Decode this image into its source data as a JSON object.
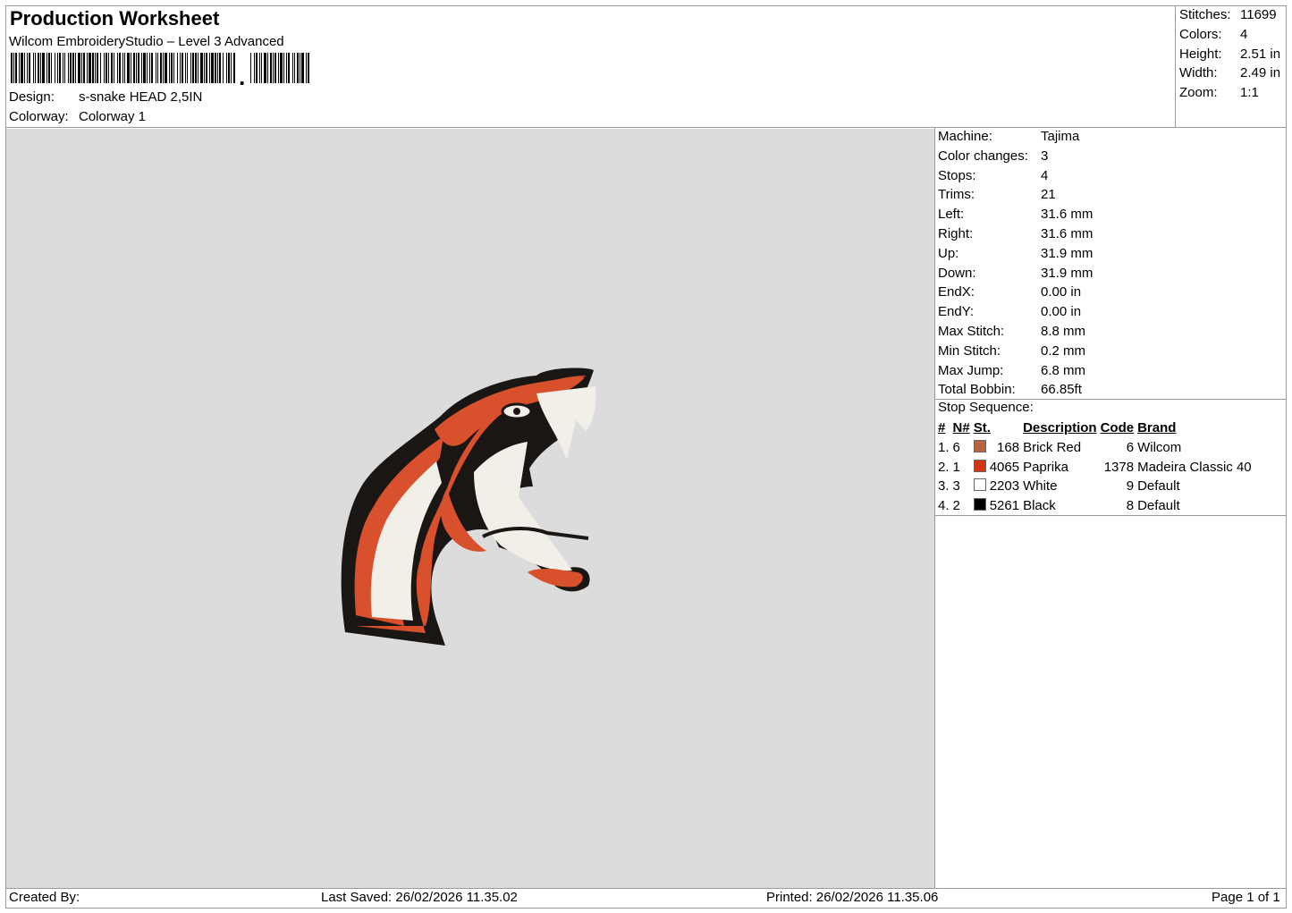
{
  "header": {
    "title": "Production Worksheet",
    "software": "Wilcom EmbroideryStudio – Level 3 Advanced",
    "design_label": "Design:",
    "design_value": "s-snake HEAD 2,5IN",
    "colorway_label": "Colorway:",
    "colorway_value": "Colorway 1"
  },
  "summary": [
    {
      "label": "Stitches:",
      "value": "11699"
    },
    {
      "label": "Colors:",
      "value": "4"
    },
    {
      "label": "Height:",
      "value": "2.51 in"
    },
    {
      "label": "Width:",
      "value": "2.49 in"
    },
    {
      "label": "Zoom:",
      "value": "1:1"
    }
  ],
  "stats": [
    {
      "label": "Machine:",
      "value": "Tajima"
    },
    {
      "label": "Color changes:",
      "value": "3"
    },
    {
      "label": "Stops:",
      "value": "4"
    },
    {
      "label": "Trims:",
      "value": "21"
    },
    {
      "label": "Left:",
      "value": "31.6 mm"
    },
    {
      "label": "Right:",
      "value": "31.6 mm"
    },
    {
      "label": "Up:",
      "value": "31.9 mm"
    },
    {
      "label": "Down:",
      "value": "31.9 mm"
    },
    {
      "label": "EndX:",
      "value": "0.00 in"
    },
    {
      "label": "EndY:",
      "value": "0.00 in"
    },
    {
      "label": "Max Stitch:",
      "value": "8.8 mm"
    },
    {
      "label": "Min Stitch:",
      "value": "0.2 mm"
    },
    {
      "label": "Max Jump:",
      "value": "6.8 mm"
    },
    {
      "label": "Total Bobbin:",
      "value": "66.85ft"
    }
  ],
  "stop_sequence": {
    "title": "Stop Sequence:",
    "headers": [
      "#",
      "N#",
      "St.",
      "Description",
      "Code",
      "Brand"
    ],
    "rows": [
      {
        "idx": "1.",
        "n": "6",
        "color": "#b9643f",
        "st": "168",
        "desc": "Brick Red",
        "code": "6",
        "brand": "Wilcom"
      },
      {
        "idx": "2.",
        "n": "1",
        "color": "#d2340f",
        "st": "4065",
        "desc": "Paprika",
        "code": "1378",
        "brand": "Madeira Classic 40"
      },
      {
        "idx": "3.",
        "n": "3",
        "color": "#ffffff",
        "st": "2203",
        "desc": "White",
        "code": "9",
        "brand": "Default"
      },
      {
        "idx": "4.",
        "n": "2",
        "color": "#000000",
        "st": "5261",
        "desc": "Black",
        "code": "8",
        "brand": "Default"
      }
    ]
  },
  "footer": {
    "created_by": "Created By:",
    "last_saved": "Last Saved: 26/02/2026 11.35.02",
    "printed": "Printed: 26/02/2026 11.35.06",
    "page": "Page 1 of 1"
  },
  "design_colors": {
    "orange": "#d9512c",
    "white": "#f2efe9",
    "black": "#1a1614",
    "canvas": "#dcdcdc"
  }
}
